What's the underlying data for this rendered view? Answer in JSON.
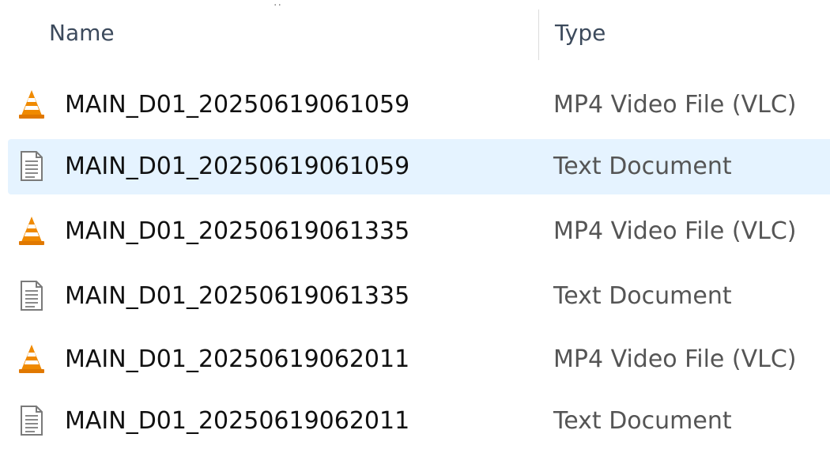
{
  "columns": {
    "name": "Name",
    "type": "Type"
  },
  "colors": {
    "selected_row": "#e5f3ff",
    "vlc_orange": "#f08a00"
  },
  "files": [
    {
      "name": "MAIN_D01_20250619061059",
      "type": "MP4 Video File (VLC)",
      "icon": "vlc-cone-icon",
      "selected": false
    },
    {
      "name": "MAIN_D01_20250619061059",
      "type": "Text Document",
      "icon": "text-document-icon",
      "selected": true
    },
    {
      "name": "MAIN_D01_20250619061335",
      "type": "MP4 Video File (VLC)",
      "icon": "vlc-cone-icon",
      "selected": false
    },
    {
      "name": "MAIN_D01_20250619061335",
      "type": "Text Document",
      "icon": "text-document-icon",
      "selected": false
    },
    {
      "name": "MAIN_D01_20250619062011",
      "type": "MP4 Video File (VLC)",
      "icon": "vlc-cone-icon",
      "selected": false
    },
    {
      "name": "MAIN_D01_20250619062011",
      "type": "Text Document",
      "icon": "text-document-icon",
      "selected": false
    }
  ]
}
